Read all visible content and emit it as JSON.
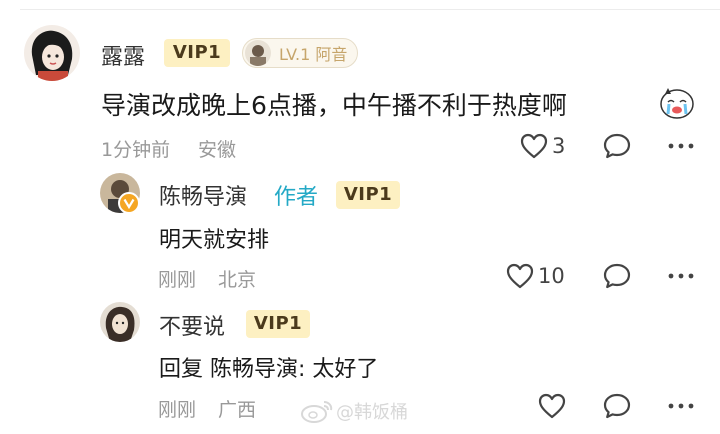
{
  "comment": {
    "username": "露露",
    "vip": "VIP1",
    "fan_badge": "LV.1 阿音",
    "text": "导演改成晚上6点播，中午播不利于热度啊",
    "emoji_icon": "crying-face-emoji",
    "time": "1分钟前",
    "location": "安徽",
    "likes": "3"
  },
  "replies": [
    {
      "username": "陈畅导演",
      "author_tag": "作者",
      "vip": "VIP1",
      "text": "明天就安排",
      "time": "刚刚",
      "location": "北京",
      "likes": "10"
    },
    {
      "username": "不要说",
      "vip": "VIP1",
      "text": "回复 陈畅导演: 太好了",
      "time": "刚刚",
      "location": "广西",
      "likes": ""
    }
  ],
  "watermark": "@韩饭桶",
  "colors": {
    "vip_bg": "#fdf0c2",
    "author_tag": "#24a9c6",
    "meta_gray": "#999999"
  }
}
